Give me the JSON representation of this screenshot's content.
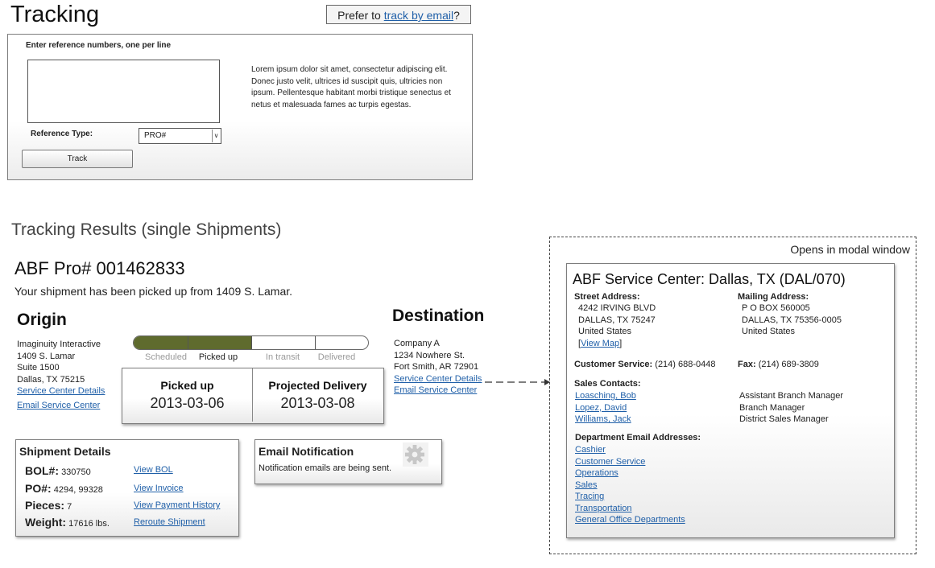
{
  "header": {
    "title": "Tracking",
    "email_prefix": "Prefer to ",
    "email_link": "track by email",
    "email_suffix": "?"
  },
  "form": {
    "ref_label": "Enter reference numbers, one per line",
    "textarea_value": "",
    "description": "Lorem ipsum dolor sit amet, consectetur adipiscing elit. Donec justo velit, ultrices id suscipit quis, ultricies non ipsum. Pellentesque habitant morbi tristique senectus et netus et malesuada fames ac turpis egestas.",
    "reftype_label": "Reference Type:",
    "reftype_value": "PRO#",
    "track_label": "Track"
  },
  "results": {
    "heading": "Tracking Results (single Shipments)",
    "pro_number": "ABF Pro# 001462833",
    "status_message": "Your shipment has been picked up from 1409 S. Lamar.",
    "origin": {
      "title": "Origin",
      "lines": [
        "Imaginuity Interactive",
        "1409 S. Lamar",
        "Suite 1500",
        "Dallas, TX  75215"
      ],
      "service_center_link": "Service Center Details",
      "email_link": "Email Service Center"
    },
    "destination": {
      "title": "Destination",
      "lines": [
        "Company A",
        "1234 Nowhere St.",
        "Fort Smith, AR  72901"
      ],
      "service_center_link": "Service Center Details",
      "email_link": "Email Service Center"
    },
    "progress": {
      "stages": [
        "Scheduled",
        "Picked up",
        "In transit",
        "Delivered"
      ],
      "current_stage_index": 1,
      "fill_color": "#5f6b2e"
    },
    "dates": {
      "picked_up_label": "Picked up",
      "picked_up_value": "2013-03-06",
      "projected_label": "Projected Delivery",
      "projected_value": "2013-03-08"
    },
    "details": {
      "title": "Shipment Details",
      "rows": [
        {
          "key": "BOL#:",
          "value": "330750",
          "link": "View BOL"
        },
        {
          "key": "PO#:",
          "value": "4294, 99328",
          "link": "View Invoice"
        },
        {
          "key": "Pieces:",
          "value": "7",
          "link": "View Payment History"
        },
        {
          "key": "Weight:",
          "value": "17616 lbs.",
          "link": "Reroute Shipment"
        }
      ]
    },
    "email_notification": {
      "title": "Email Notification",
      "text": "Notification emails are being sent.",
      "icon": "gear-icon"
    }
  },
  "modal": {
    "caption": "Opens in modal window",
    "title": "ABF Service Center: Dallas, TX (DAL/070)",
    "street_label": "Street Address:",
    "street_lines": [
      "4242 IRVING BLVD",
      "DALLAS, TX 75247",
      "United States"
    ],
    "view_map": "View Map",
    "mailing_label": "Mailing Address:",
    "mailing_lines": [
      "P O BOX 560005",
      "DALLAS, TX 75356-0005",
      "United States"
    ],
    "customer_service_label": "Customer Service:",
    "customer_service_value": "(214) 688-0448",
    "fax_label": "Fax:",
    "fax_value": "(214) 689-3809",
    "sales_label": "Sales Contacts:",
    "sales_contacts": [
      {
        "name": "Loasching, Bob",
        "role": "Assistant Branch Manager"
      },
      {
        "name": "Lopez, David",
        "role": "Branch Manager"
      },
      {
        "name": "Williams, Jack",
        "role": "District Sales Manager"
      }
    ],
    "dept_label": "Department Email Addresses:",
    "departments": [
      "Cashier",
      "Customer Service",
      "Operations",
      "Sales",
      "Tracing",
      "Transportation",
      "General Office Departments"
    ]
  }
}
